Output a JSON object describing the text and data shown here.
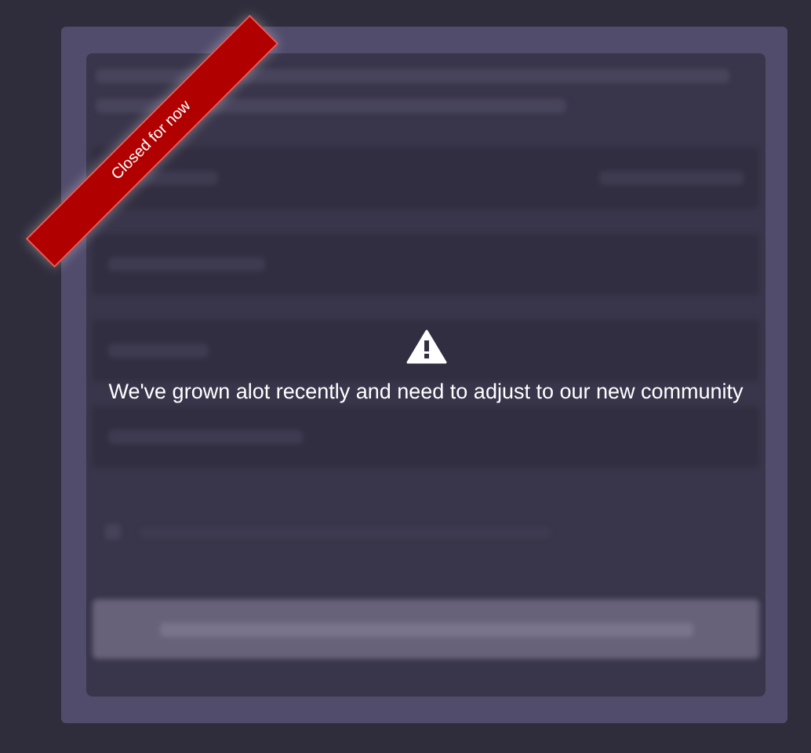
{
  "ribbon": {
    "label": "Closed for now"
  },
  "notice": {
    "message": "We've grown alot recently and need to adjust to our new community"
  }
}
